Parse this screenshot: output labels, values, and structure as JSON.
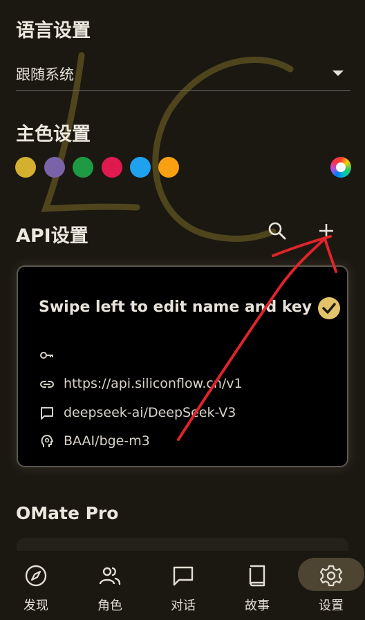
{
  "language": {
    "title": "语言设置",
    "selected": "跟随系统"
  },
  "theme": {
    "title": "主色设置",
    "swatches": [
      "#d4b02f",
      "#7b63a9",
      "#1e9a45",
      "#e0194f",
      "#1ea2f0",
      "#f8a012"
    ],
    "palette_icon": "palette-icon"
  },
  "api": {
    "title": "API设置",
    "search_icon": "search-icon",
    "add_icon": "plus-icon",
    "card": {
      "title": "Swipe left to edit name and key",
      "key": "",
      "url": "https://api.siliconflow.cn/v1",
      "chat_model": "deepseek-ai/DeepSeek-V3",
      "embedding_model": "BAAI/bge-m3"
    }
  },
  "pro": {
    "title": "OMate Pro"
  },
  "nav": {
    "items": [
      {
        "label": "发现",
        "icon": "compass-icon"
      },
      {
        "label": "角色",
        "icon": "people-icon"
      },
      {
        "label": "对话",
        "icon": "chat-icon"
      },
      {
        "label": "故事",
        "icon": "book-icon"
      },
      {
        "label": "设置",
        "icon": "gear-icon"
      }
    ],
    "active_index": 4
  },
  "colors": {
    "accent": "#e4c26a",
    "background": "#1b1812",
    "annotation": "#e0242a"
  }
}
